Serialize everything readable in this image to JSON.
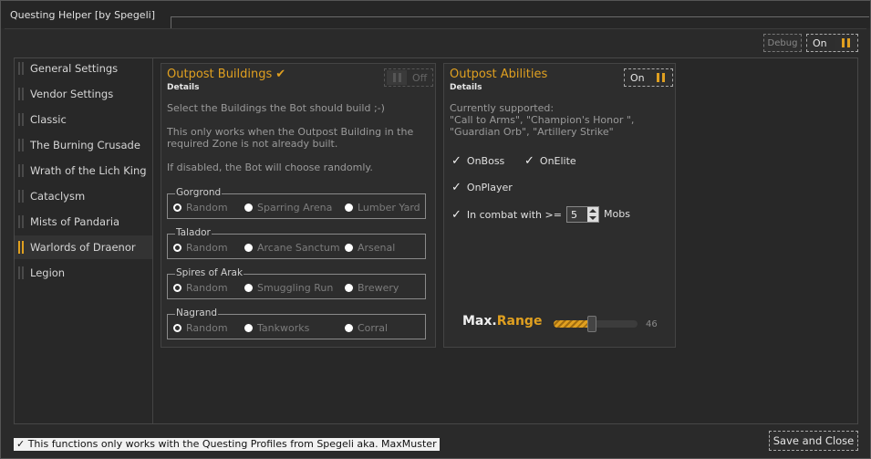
{
  "window": {
    "title": "Questing Helper [by Spegeli]"
  },
  "top_controls": {
    "debug_label": "Debug",
    "toggle_label": "On"
  },
  "sidebar": {
    "items": [
      {
        "label": "General Settings",
        "active": false
      },
      {
        "label": "Vendor Settings",
        "active": false
      },
      {
        "label": "Classic",
        "active": false
      },
      {
        "label": "The Burning Crusade",
        "active": false
      },
      {
        "label": "Wrath of the Lich King",
        "active": false
      },
      {
        "label": "Cataclysm",
        "active": false
      },
      {
        "label": "Mists of Pandaria",
        "active": false
      },
      {
        "label": "Warlords of Draenor",
        "active": true
      },
      {
        "label": "Legion",
        "active": false
      }
    ]
  },
  "outpost_buildings": {
    "title": "Outpost  Buildings",
    "subtitle": "Details",
    "toggle_label": "Off",
    "text1": "Select the Buildings the Bot should build ;-)",
    "text2a": "This only works when the Outpost Building in the",
    "text2b": "required Zone is not already built.",
    "text3": "If disabled, the Bot will choose randomly.",
    "groups": [
      {
        "name": "Gorgrond",
        "options": [
          "Random",
          "Sparring Arena",
          "Lumber Yard"
        ],
        "selected": 0
      },
      {
        "name": "Talador",
        "options": [
          "Random",
          "Arcane Sanctum",
          "Arsenal"
        ],
        "selected": 0
      },
      {
        "name": "Spires of Arak",
        "options": [
          "Random",
          "Smuggling Run",
          "Brewery"
        ],
        "selected": 0
      },
      {
        "name": "Nagrand",
        "options": [
          "Random",
          "Tankworks",
          "Corral"
        ],
        "selected": 0
      }
    ]
  },
  "outpost_abilities": {
    "title": "Outpost Abilities",
    "subtitle": "Details",
    "toggle_label": "On",
    "supported_title": "Currently supported:",
    "supported_line1": "\"Call to Arms\", \"Champion's Honor \",",
    "supported_line2": "\"Guardian Orb\", \"Artillery Strike\"",
    "checkboxes": {
      "on_boss": "OnBoss",
      "on_elite": "OnElite",
      "on_player": "OnPlayer",
      "in_combat": "In combat with >="
    },
    "mobs_value": "5",
    "mobs_label": "Mobs",
    "max_label": "Max.",
    "range_label": "Range",
    "range_value": "46",
    "range_fraction": 0.46
  },
  "footer": {
    "note": "✓ This functions only works with the Questing Profiles from Spegeli aka. MaxMuster",
    "save_close": "Save and Close"
  },
  "colors": {
    "accent": "#e0a020",
    "background": "#2b2b2b"
  }
}
